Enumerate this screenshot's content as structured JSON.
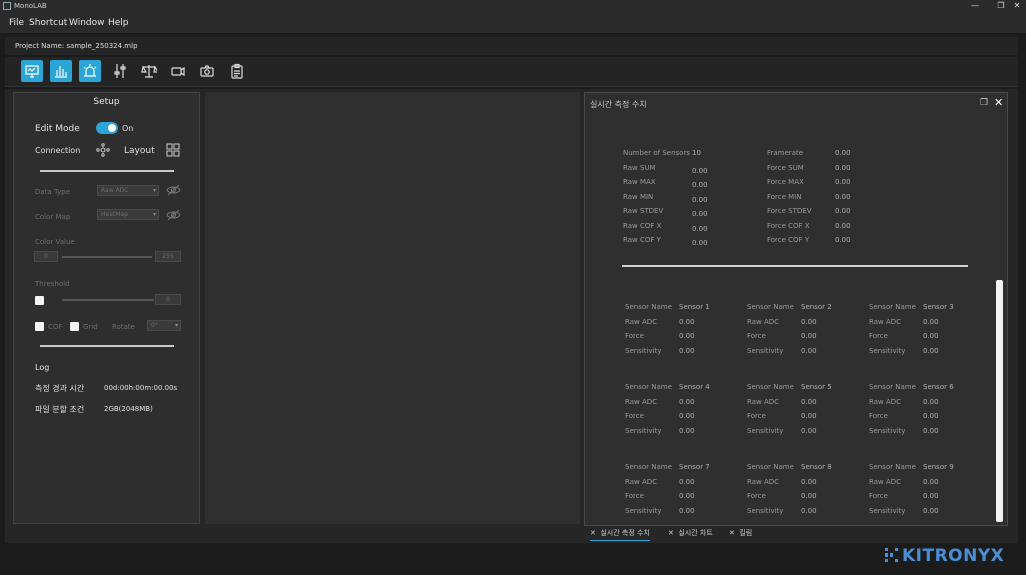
{
  "window": {
    "title": "MonoLAB",
    "controls": [
      "—",
      "❐",
      "✕"
    ]
  },
  "menu": [
    "File",
    "Shortcut",
    "Window",
    "Help"
  ],
  "project": {
    "label": "Project Name: sample_250324.mlp"
  },
  "toolbar": {
    "tools": [
      {
        "name": "monitor-tool",
        "icon": "monitor-icon",
        "active": true
      },
      {
        "name": "bar-chart-tool",
        "icon": "bar-chart-icon",
        "active": true
      },
      {
        "name": "alarm-tool",
        "icon": "alarm-icon",
        "active": true
      },
      {
        "name": "sliders-tool",
        "icon": "sliders-icon",
        "active": false
      },
      {
        "name": "balance-tool",
        "icon": "balance-scale-icon",
        "active": false
      },
      {
        "name": "video-tool",
        "icon": "video-camera-icon",
        "active": false
      },
      {
        "name": "camera-tool",
        "icon": "camera-icon",
        "active": false
      },
      {
        "name": "clipboard-tool",
        "icon": "clipboard-icon",
        "active": false
      }
    ],
    "accent": "#2ba5d6"
  },
  "setup": {
    "title": "Setup",
    "edit_mode_label": "Edit Mode",
    "edit_mode_state": "On",
    "connection_label": "Connection",
    "layout_label": "Layout",
    "data_type_label": "Data Type",
    "data_type_value": "Raw ADC",
    "color_map_label": "Color Map",
    "color_map_value": "HeatMap",
    "color_value_label": "Color Value",
    "color_min": "0",
    "color_max": "255",
    "threshold_label": "Threshold",
    "threshold_value": "0",
    "cof_label": "COF",
    "grid_label": "Grid",
    "rotate_label": "Rotate",
    "rotate_value": "0°",
    "log_label": "Log",
    "elapsed_label": "측정 경과 시간",
    "elapsed_value": "00d:00h:00m:00.00s",
    "split_label": "파일 분할 조건",
    "split_value": "2GB(2048MB)"
  },
  "realtime": {
    "title": "실시간 측정 수치",
    "summary_left": [
      {
        "label": "Number of Sensors",
        "value": "10"
      },
      {
        "label": "Raw SUM",
        "value": "0.00"
      },
      {
        "label": "Raw MAX",
        "value": "0.00"
      },
      {
        "label": "Raw MIN",
        "value": "0.00"
      },
      {
        "label": "Raw STDEV",
        "value": "0.00"
      },
      {
        "label": "Raw COF X",
        "value": "0.00"
      },
      {
        "label": "Raw COF Y",
        "value": "0.00"
      }
    ],
    "summary_right": [
      {
        "label": "Framerate",
        "value": "0.00"
      },
      {
        "label": "Force SUM",
        "value": "0.00"
      },
      {
        "label": "Force MAX",
        "value": "0.00"
      },
      {
        "label": "Force MIN",
        "value": "0.00"
      },
      {
        "label": "Force STDEV",
        "value": "0.00"
      },
      {
        "label": "Force COF X",
        "value": "0.00"
      },
      {
        "label": "Force COF Y",
        "value": "0.00"
      }
    ],
    "field_labels": [
      "Sensor Name",
      "Raw ADC",
      "Force",
      "Sensitivity"
    ],
    "sensors": [
      {
        "name": "Sensor 1",
        "raw": "0.00",
        "force": "0.00",
        "sens": "0.00"
      },
      {
        "name": "Sensor 2",
        "raw": "0.00",
        "force": "0.00",
        "sens": "0.00"
      },
      {
        "name": "Sensor 3",
        "raw": "0.00",
        "force": "0.00",
        "sens": "0.00"
      },
      {
        "name": "Sensor 4",
        "raw": "0.00",
        "force": "0.00",
        "sens": "0.00"
      },
      {
        "name": "Sensor 5",
        "raw": "0.00",
        "force": "0.00",
        "sens": "0.00"
      },
      {
        "name": "Sensor 6",
        "raw": "0.00",
        "force": "0.00",
        "sens": "0.00"
      },
      {
        "name": "Sensor 7",
        "raw": "0.00",
        "force": "0.00",
        "sens": "0.00"
      },
      {
        "name": "Sensor 8",
        "raw": "0.00",
        "force": "0.00",
        "sens": "0.00"
      },
      {
        "name": "Sensor 9",
        "raw": "0.00",
        "force": "0.00",
        "sens": "0.00"
      }
    ]
  },
  "tabs": [
    {
      "label": "실시간 측정 수치",
      "active": true
    },
    {
      "label": "실시간 차트",
      "active": false
    },
    {
      "label": "킬림",
      "active": false
    }
  ],
  "brand": "KITRONYX"
}
